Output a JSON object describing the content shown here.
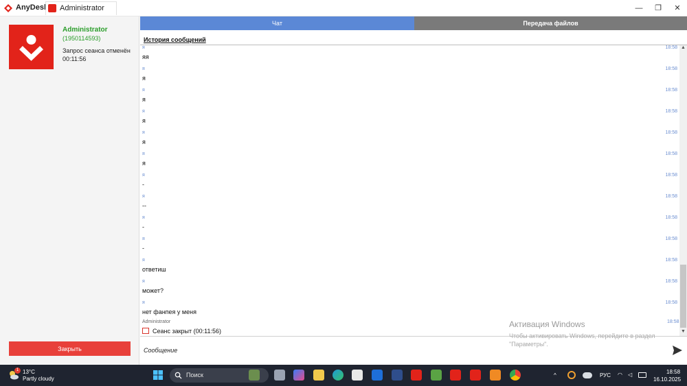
{
  "window": {
    "app_name": "AnyDesk",
    "tab_label": "Administrator"
  },
  "session": {
    "user_name": "Administrator",
    "user_id": "(1950114593)",
    "status": "Запрос сеанса отменён",
    "timer": "00:11:56",
    "close_label": "Закрыть"
  },
  "tabs": {
    "chat": "Чат",
    "files": "Передача файлов"
  },
  "chat": {
    "history_title": "История сообщений",
    "messages": [
      {
        "sender": "я",
        "time": "18:58",
        "text": "яя"
      },
      {
        "sender": "я",
        "time": "18:58",
        "text": "я"
      },
      {
        "sender": "я",
        "time": "18:58",
        "text": "я"
      },
      {
        "sender": "я",
        "time": "18:58",
        "text": "я"
      },
      {
        "sender": "я",
        "time": "18:58",
        "text": "я"
      },
      {
        "sender": "я",
        "time": "18:58",
        "text": "я"
      },
      {
        "sender": "я",
        "time": "18:58",
        "text": "-"
      },
      {
        "sender": "я",
        "time": "18:58",
        "text": "--"
      },
      {
        "sender": "я",
        "time": "18:58",
        "text": "-"
      },
      {
        "sender": "я",
        "time": "18:58",
        "text": "-"
      },
      {
        "sender": "я",
        "time": "18:58",
        "text": "ответиш"
      },
      {
        "sender": "я",
        "time": "18:58",
        "text": "может?"
      },
      {
        "sender": "я",
        "time": "18:58",
        "text": "нет фанпея у меня"
      }
    ],
    "system_sender": "Administrator",
    "system_time": "18:58",
    "system_text": "Сеанс закрыт (00:11:56)",
    "input_placeholder": "Сообщение"
  },
  "watermark": {
    "title": "Активация Windows",
    "subtitle": "Чтобы активировать Windows, перейдите в раздел \"Параметры\"."
  },
  "taskbar": {
    "weather_temp": "13°C",
    "weather_desc": "Partly cloudy",
    "weather_badge": "1",
    "search_label": "Поиск",
    "language": "РУС",
    "time": "18:58",
    "date": "16.10.2025"
  },
  "colors": {
    "brand_red": "#e2231a",
    "chat_tab": "#5b88d6",
    "files_tab": "#7a7a7a",
    "status_green": "#2a9d2a"
  }
}
